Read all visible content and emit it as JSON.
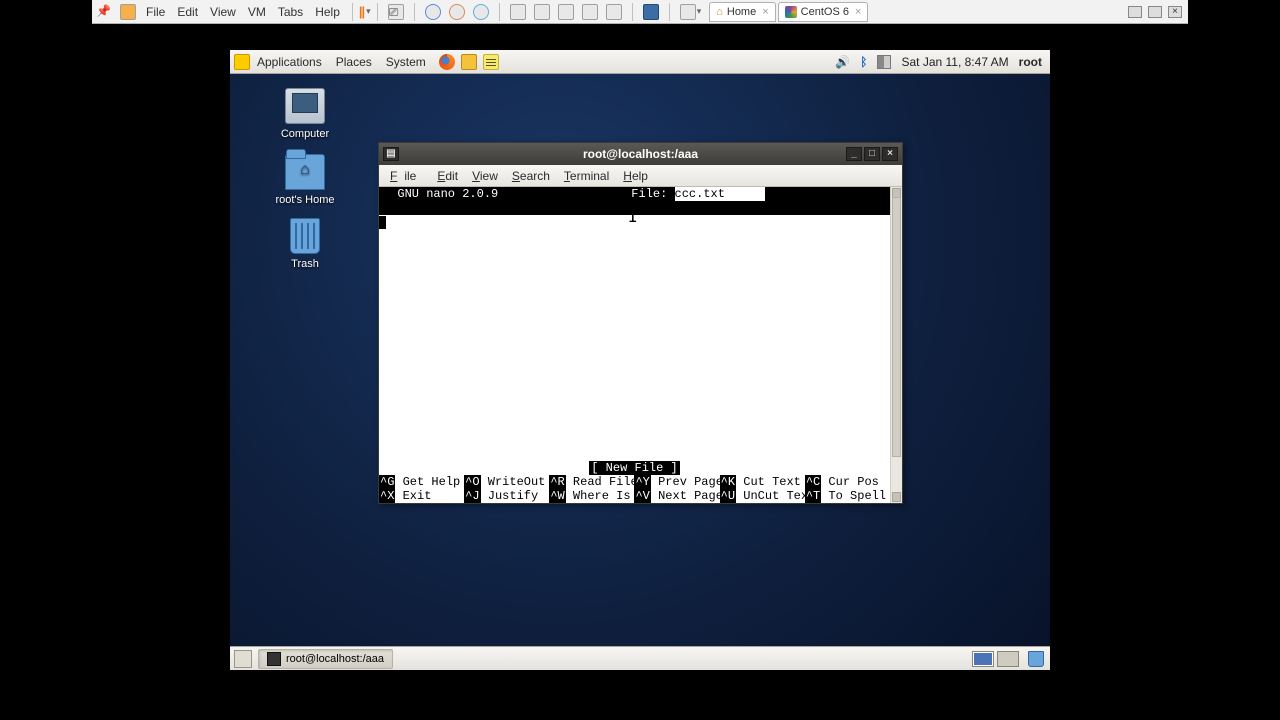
{
  "vmware": {
    "menus": {
      "file": "File",
      "edit": "Edit",
      "view": "View",
      "vm": "VM",
      "tabs": "Tabs",
      "help": "Help"
    },
    "tabs": [
      {
        "icon": "home",
        "label": "Home"
      },
      {
        "icon": "centos",
        "label": "CentOS 6"
      }
    ]
  },
  "gnome_top": {
    "menus": {
      "applications": "Applications",
      "places": "Places",
      "system": "System"
    },
    "clock": "Sat Jan 11,  8:47 AM",
    "user": "root"
  },
  "desktop": {
    "icons": [
      {
        "name": "computer",
        "label": "Computer"
      },
      {
        "name": "home",
        "label": "root's Home"
      },
      {
        "name": "trash",
        "label": "Trash"
      }
    ]
  },
  "terminal": {
    "title": "root@localhost:/aaa",
    "menu": {
      "file": "File",
      "edit": "Edit",
      "view": "View",
      "search": "Search",
      "terminal": "Terminal",
      "help": "Help"
    },
    "nano": {
      "app": "  GNU nano 2.0.9",
      "file_label": "File: ",
      "file_name": "ccc.txt",
      "status": "[ New File ]",
      "shortcuts": [
        [
          "^G",
          "Get Help"
        ],
        [
          "^O",
          "WriteOut"
        ],
        [
          "^R",
          "Read File"
        ],
        [
          "^Y",
          "Prev Page"
        ],
        [
          "^K",
          "Cut Text"
        ],
        [
          "^C",
          "Cur Pos"
        ],
        [
          "^X",
          "Exit"
        ],
        [
          "^J",
          "Justify"
        ],
        [
          "^W",
          "Where Is"
        ],
        [
          "^V",
          "Next Page"
        ],
        [
          "^U",
          "UnCut Text"
        ],
        [
          "^T",
          "To Spell"
        ]
      ]
    }
  },
  "taskbar": {
    "task": "root@localhost:/aaa"
  }
}
